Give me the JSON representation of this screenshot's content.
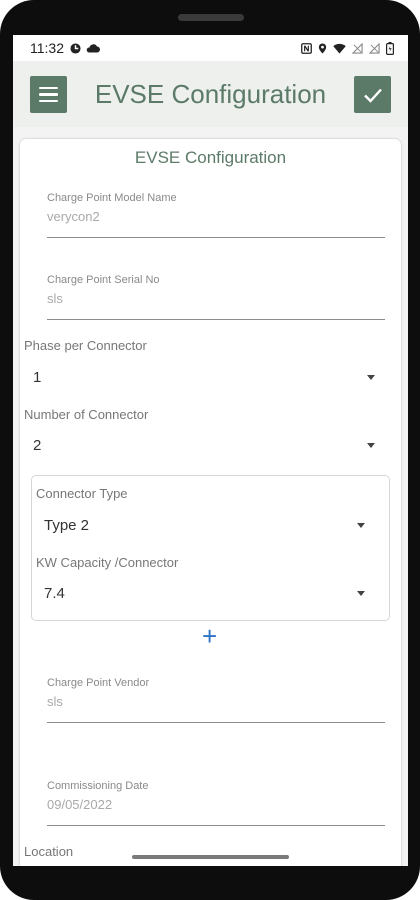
{
  "status_bar": {
    "time": "11:32",
    "left_icons": [
      "fitness-icon",
      "cloud-icon"
    ],
    "right_icons": [
      "nfc-icon",
      "location-icon",
      "wifi-icon",
      "signal-off-icon",
      "signal-off-icon",
      "battery-icon"
    ]
  },
  "app_bar": {
    "title": "EVSE Configuration",
    "menu_icon": "menu-icon",
    "save_icon": "check-icon",
    "color": "#5c7a68"
  },
  "form": {
    "title": "EVSE Configuration",
    "model_name": {
      "label": "Charge Point Model Name",
      "value": "verycon2"
    },
    "serial_no": {
      "label": "Charge Point Serial No",
      "value": "sls"
    },
    "phase_per_connector": {
      "label": "Phase per Connector",
      "value": "1"
    },
    "number_of_connector": {
      "label": "Number of Connector",
      "value": "2"
    },
    "connector": {
      "type": {
        "label": "Connector Type",
        "value": "Type 2"
      },
      "capacity": {
        "label": "KW Capacity /Connector",
        "value": "7.4"
      }
    },
    "add_connector_icon": "plus-icon",
    "vendor": {
      "label": "Charge Point Vendor",
      "value": "sls"
    },
    "commissioning_date": {
      "label": "Commissioning Date",
      "value": "09/05/2022"
    },
    "location": {
      "label": "Location"
    }
  }
}
